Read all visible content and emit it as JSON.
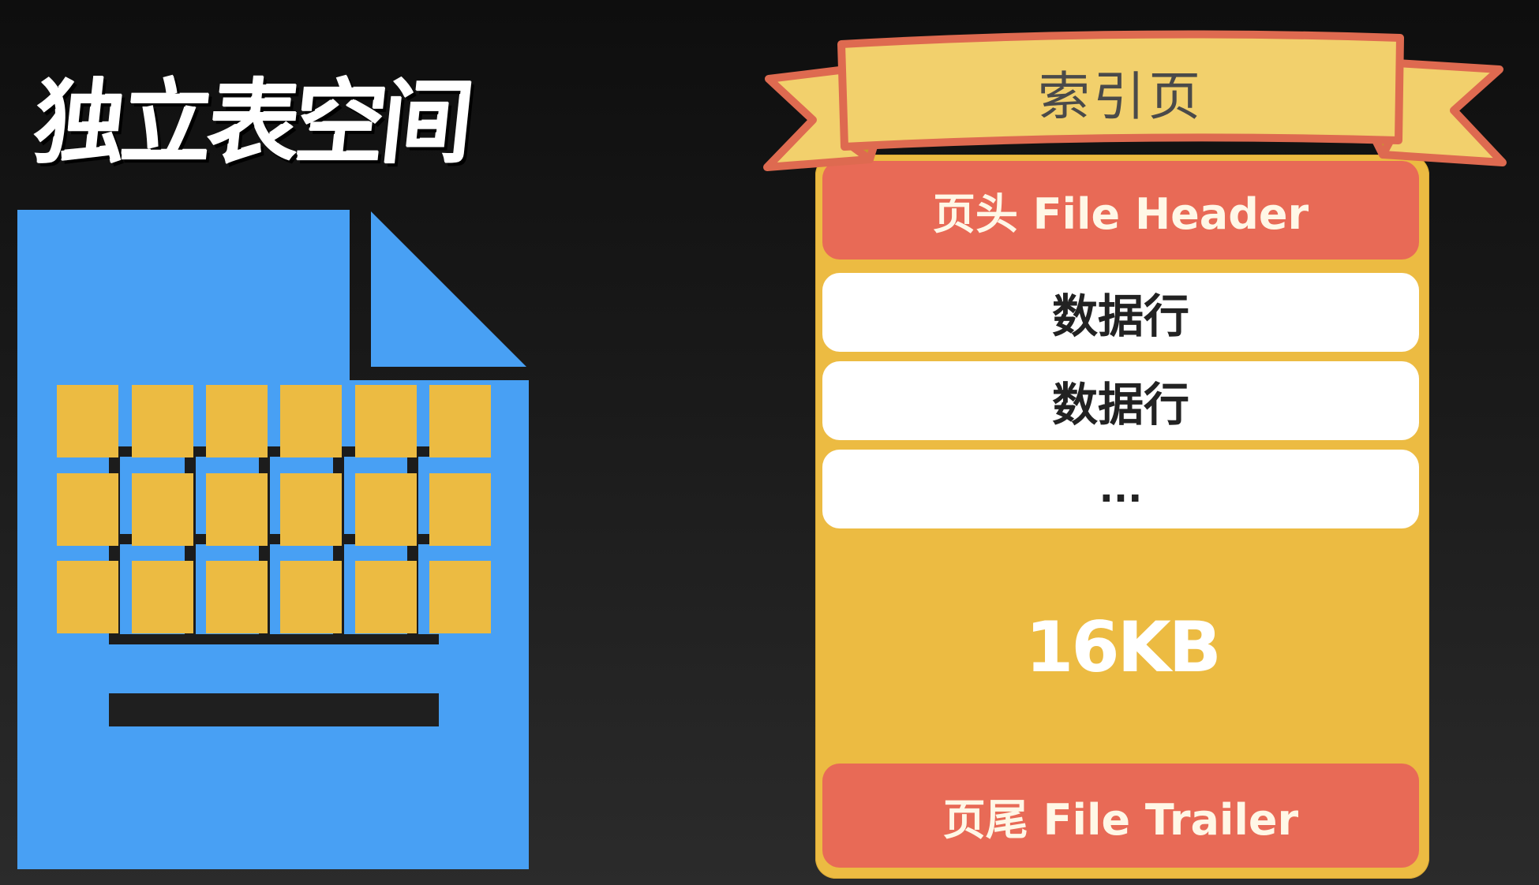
{
  "title": "独立表空间",
  "banner": {
    "label": "索引页"
  },
  "page": {
    "header": "页头 File Header",
    "rows": [
      "数据行",
      "数据行",
      "..."
    ],
    "size": "16KB",
    "trailer": "页尾 File Trailer"
  },
  "colors": {
    "file": "#48a0f4",
    "cell": "#ecbb42",
    "page": "#ecbb42",
    "header": "#e86a56",
    "banner": "#f2d06c",
    "banner_edge": "#de6a50"
  }
}
